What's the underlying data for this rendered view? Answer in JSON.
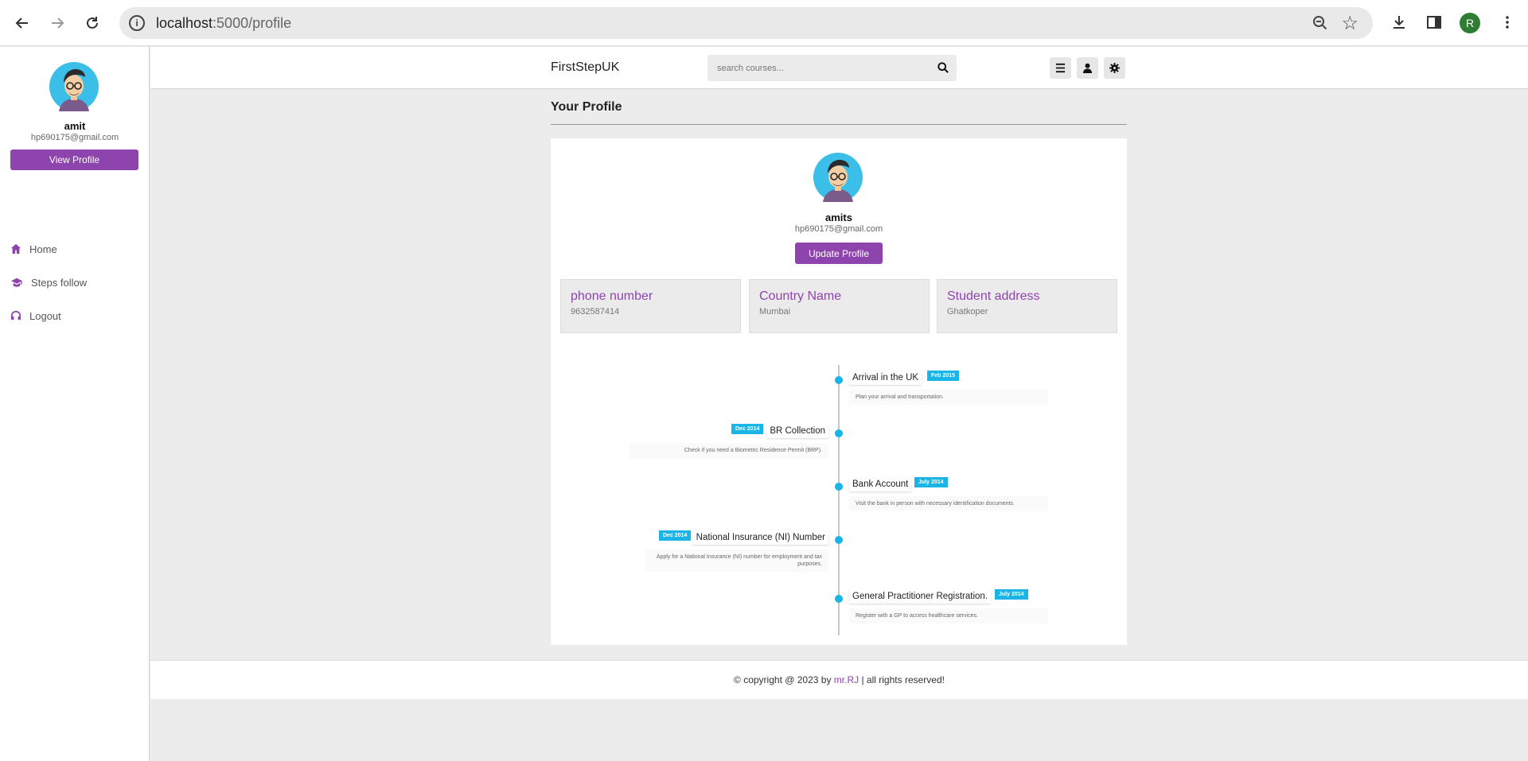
{
  "browser": {
    "url_host": "localhost",
    "url_path": ":5000/profile",
    "profile_initial": "R"
  },
  "sidebar": {
    "user_name": "amit",
    "user_email": "hp690175@gmail.com",
    "view_profile_label": "View Profile",
    "items": [
      {
        "label": "Home",
        "icon": "home-icon"
      },
      {
        "label": "Steps follow",
        "icon": "graduation-cap-icon"
      },
      {
        "label": "Logout",
        "icon": "headset-icon"
      }
    ]
  },
  "header": {
    "brand": "FirstStepUK",
    "search_placeholder": "search courses..."
  },
  "main": {
    "page_title": "Your Profile",
    "profile": {
      "name": "amits",
      "email": "hp690175@gmail.com",
      "update_label": "Update Profile"
    },
    "info_boxes": [
      {
        "label": "phone number",
        "value": "9632587414"
      },
      {
        "label": "Country Name",
        "value": "Mumbai"
      },
      {
        "label": "Student address",
        "value": "Ghatkoper"
      }
    ],
    "timeline": [
      {
        "side": "right",
        "title": "Arrival in the UK",
        "date": "Feb 2015",
        "desc": "Plan your arrival and transportation."
      },
      {
        "side": "left",
        "title": "BR Collection",
        "date": "Dec 2014",
        "desc": "Check if you need a Biometric Residence Permit (BRP)."
      },
      {
        "side": "right",
        "title": "Bank Account",
        "date": "July 2014",
        "desc": "Visit the bank in person with necessary identification documents."
      },
      {
        "side": "left",
        "title": "National Insurance (NI) Number",
        "date": "Dec 2014",
        "desc": "Apply for a National Insurance (NI) number for employment and tax purposes."
      },
      {
        "side": "right",
        "title": "General Practitioner Registration.",
        "date": "July 2014",
        "desc": "Register with a GP to access healthcare services."
      }
    ]
  },
  "footer": {
    "prefix": "© copyright @ 2023 by ",
    "brand": "mr.RJ",
    "suffix": " | all rights reserved!"
  },
  "colors": {
    "accent": "#8e44ad",
    "timeline": "#1ab5e6"
  }
}
